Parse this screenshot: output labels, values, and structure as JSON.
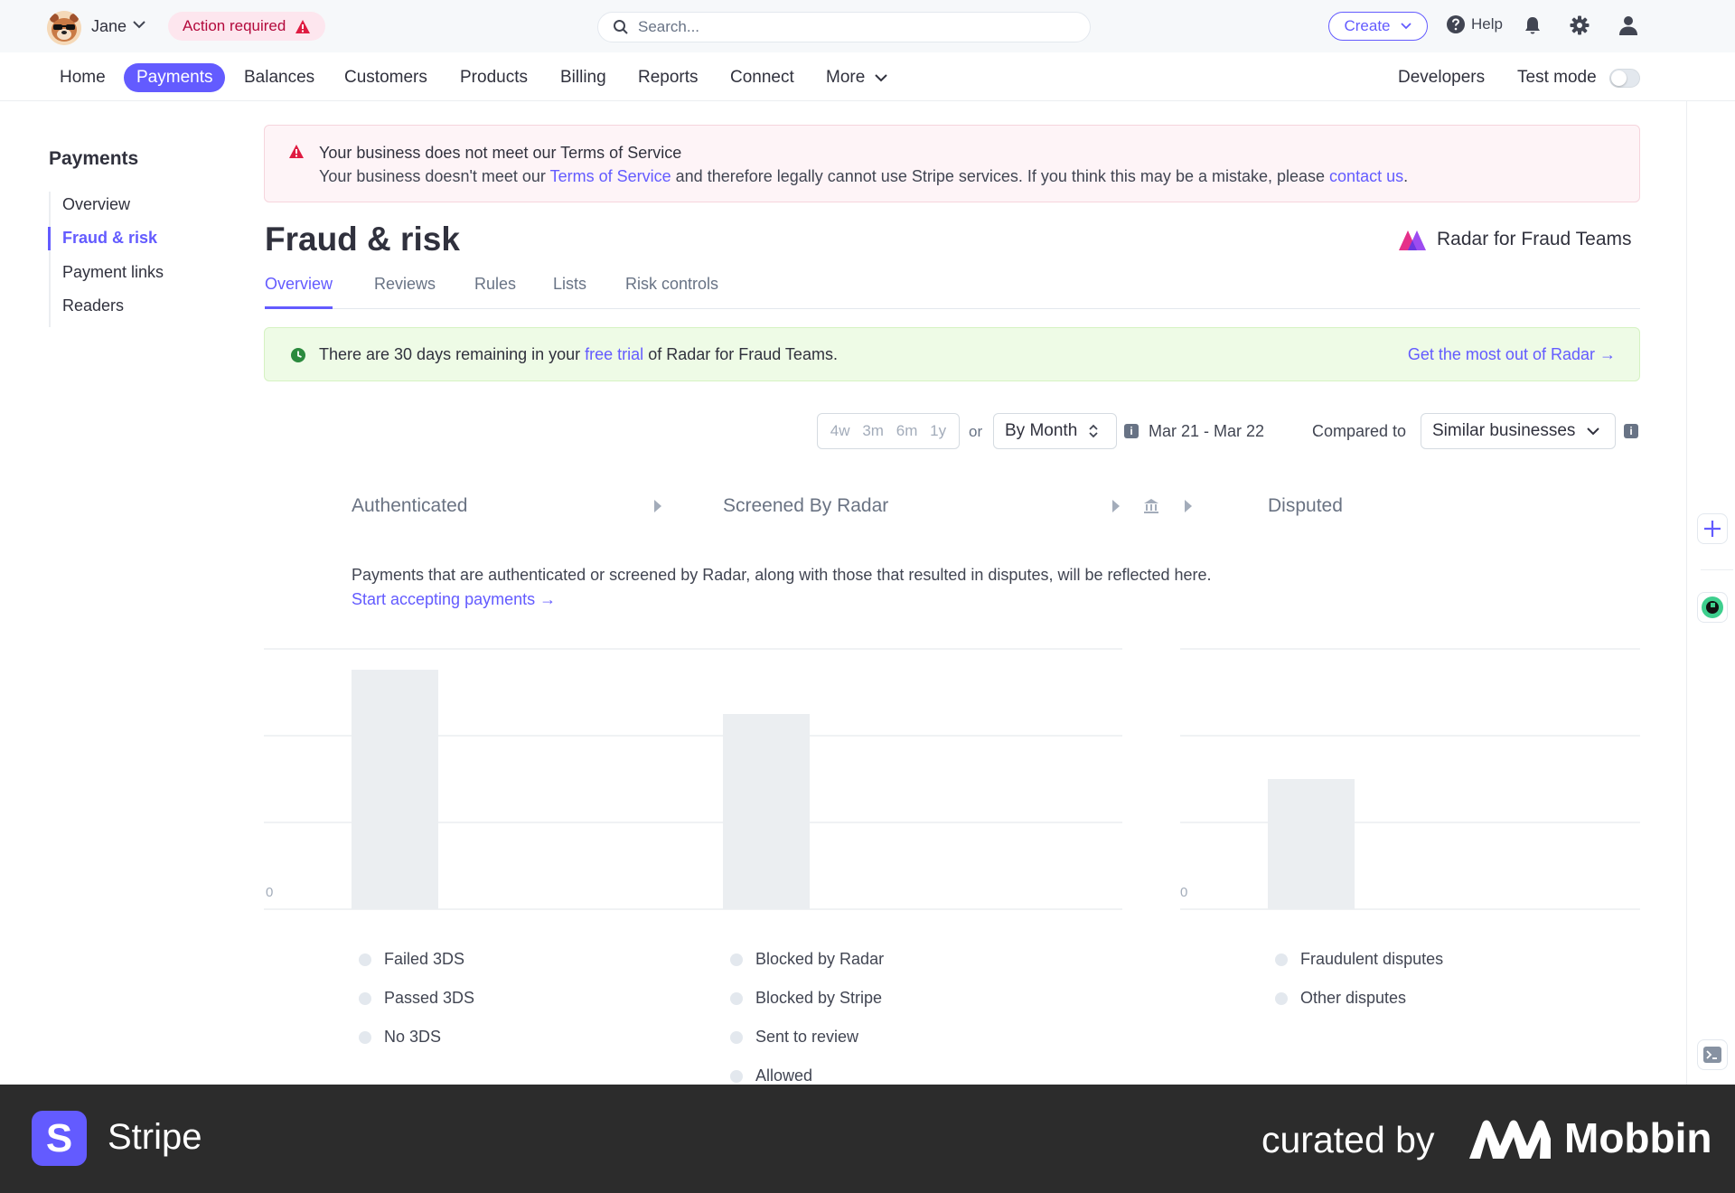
{
  "topbar": {
    "user_name": "Jane",
    "action_badge": "Action required",
    "search_placeholder": "Search...",
    "create_label": "Create",
    "help_label": "Help"
  },
  "nav": {
    "items": [
      "Home",
      "Payments",
      "Balances",
      "Customers",
      "Products",
      "Billing",
      "Reports",
      "Connect",
      "More"
    ],
    "active": "Payments",
    "developers": "Developers",
    "test_mode": "Test mode",
    "test_mode_on": false
  },
  "sidebar": {
    "title": "Payments",
    "items": [
      "Overview",
      "Fraud & risk",
      "Payment links",
      "Readers"
    ],
    "active": "Fraud & risk"
  },
  "alert": {
    "title": "Your business does not meet our Terms of Service",
    "body_1": "Your business doesn't meet our ",
    "body_link_1": "Terms of Service",
    "body_2": " and therefore legally cannot use Stripe services. If you think this may be a mistake, please ",
    "body_link_2": "contact us",
    "body_3": "."
  },
  "page": {
    "title": "Fraud & risk",
    "product": "Radar for Fraud Teams"
  },
  "tabs": [
    "Overview",
    "Reviews",
    "Rules",
    "Lists",
    "Risk controls"
  ],
  "trial": {
    "text_1": "There are 30 days remaining in your ",
    "link": "free trial",
    "text_2": " of Radar for Fraud Teams.",
    "cta": "Get the most out of Radar →"
  },
  "filters": {
    "ranges": [
      "4w",
      "3m",
      "6m",
      "1y"
    ],
    "or_label": "or",
    "interval": "By Month",
    "date_range": "Mar 21 - Mar 22",
    "compared_label": "Compared to",
    "compared_value": "Similar businesses"
  },
  "flow": {
    "steps": [
      "Authenticated",
      "Screened By Radar",
      "Disputed"
    ]
  },
  "empty_state": {
    "text": "Payments that are authenticated or screened by Radar, along with those that resulted in disputes, will be reflected here.",
    "link": "Start accepting payments →"
  },
  "chart_data": [
    {
      "type": "bar",
      "title": "",
      "y_tick_labels": [
        "0"
      ],
      "series": [
        {
          "name": "Authenticated",
          "legend": [
            "Failed 3DS",
            "Passed 3DS",
            "No 3DS"
          ]
        },
        {
          "name": "Screened By Radar",
          "legend": [
            "Blocked by Radar",
            "Blocked by Stripe",
            "Sent to review",
            "Allowed"
          ]
        }
      ],
      "note": "empty-state placeholder bars"
    },
    {
      "type": "bar",
      "title": "",
      "y_tick_labels": [
        "0"
      ],
      "series": [
        {
          "name": "Disputed",
          "legend": [
            "Fraudulent disputes",
            "Other disputes"
          ]
        }
      ],
      "note": "empty-state placeholder bar"
    }
  ],
  "legends": {
    "authenticated": [
      "Failed 3DS",
      "Passed 3DS",
      "No 3DS"
    ],
    "screened": [
      "Blocked by Radar",
      "Blocked by Stripe",
      "Sent to review",
      "Allowed"
    ],
    "disputed": [
      "Fraudulent disputes",
      "Other disputes"
    ]
  },
  "axis": {
    "zero_label": "0"
  },
  "placeholder_bars": {
    "authenticated": 0.92,
    "screened": 0.75,
    "disputed": 0.5
  },
  "footer": {
    "brand": "Stripe",
    "brand_initial": "S",
    "curated": "curated by",
    "mobbin": "Mobbin"
  },
  "colors": {
    "accent": "#635bff",
    "placeholder_bar": "#ebeef1",
    "alert_bg": "#fef4f7",
    "trial_bg": "#eefbe6"
  }
}
